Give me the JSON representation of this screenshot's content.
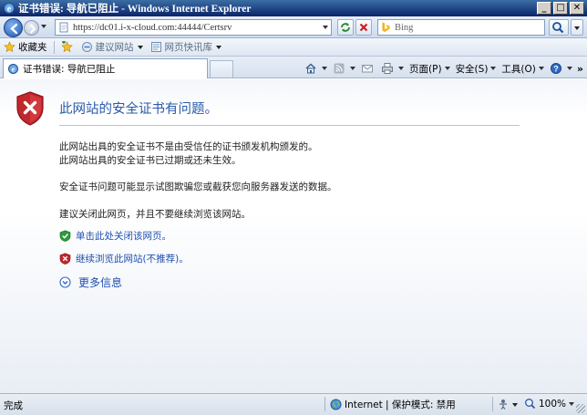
{
  "window": {
    "title": "证书错误: 导航已阻止 - Windows Internet Explorer",
    "minimize": "_",
    "maximize": "□",
    "close": "✕"
  },
  "address": {
    "url": "https://dc01.i-x-cloud.com:44444/Certsrv",
    "search_placeholder": "Bing"
  },
  "favorites": {
    "label": "收藏夹",
    "items": [
      "建议网站",
      "网页快讯库"
    ]
  },
  "tab": {
    "title": "证书错误: 导航已阻止"
  },
  "commands": {
    "page": "页面(P)",
    "safety": "安全(S)",
    "tools": "工具(O)",
    "overflow": "»"
  },
  "content": {
    "heading": "此网站的安全证书有问题。",
    "line1": "此网站出具的安全证书不是由受信任的证书颁发机构颁发的。",
    "line2": "此网站出具的安全证书已过期或还未生效。",
    "line3": "安全证书问题可能显示试图欺骗您或截获您向服务器发送的数据。",
    "line4": "建议关闭此网页，并且不要继续浏览该网站。",
    "close_link": "单击此处关闭该网页。",
    "continue_link": "继续浏览此网站(不推荐)。",
    "more_info": "更多信息"
  },
  "status": {
    "text": "完成",
    "zone": "Internet | 保护模式: 禁用",
    "zoom": "100%"
  },
  "colors": {
    "accent_blue": "#2b5aa8",
    "link_blue": "#1f4fb0",
    "shield_red": "#c0282d",
    "ok_green": "#2e9a3a"
  }
}
